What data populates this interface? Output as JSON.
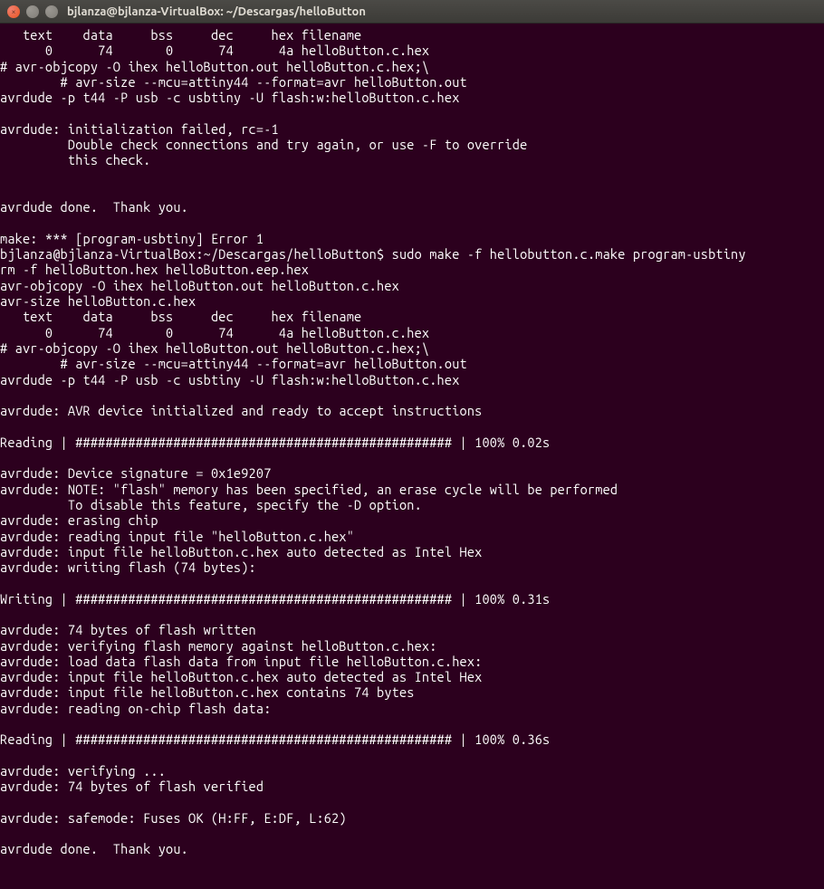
{
  "window": {
    "title": "bjlanza@bjlanza-VirtualBox: ~/Descargas/helloButton"
  },
  "terminal": {
    "lines": [
      "   text    data     bss     dec     hex filename",
      "      0      74       0      74      4a helloButton.c.hex",
      "# avr-objcopy -O ihex helloButton.out helloButton.c.hex;\\",
      "        # avr-size --mcu=attiny44 --format=avr helloButton.out",
      "avrdude -p t44 -P usb -c usbtiny -U flash:w:helloButton.c.hex",
      "",
      "avrdude: initialization failed, rc=-1",
      "         Double check connections and try again, or use -F to override",
      "         this check.",
      "",
      "",
      "avrdude done.  Thank you.",
      "",
      "make: *** [program-usbtiny] Error 1",
      "bjlanza@bjlanza-VirtualBox:~/Descargas/helloButton$ sudo make -f hellobutton.c.make program-usbtiny",
      "rm -f helloButton.hex helloButton.eep.hex",
      "avr-objcopy -O ihex helloButton.out helloButton.c.hex",
      "avr-size helloButton.c.hex",
      "   text    data     bss     dec     hex filename",
      "      0      74       0      74      4a helloButton.c.hex",
      "# avr-objcopy -O ihex helloButton.out helloButton.c.hex;\\",
      "        # avr-size --mcu=attiny44 --format=avr helloButton.out",
      "avrdude -p t44 -P usb -c usbtiny -U flash:w:helloButton.c.hex",
      "",
      "avrdude: AVR device initialized and ready to accept instructions",
      "",
      "Reading | ################################################## | 100% 0.02s",
      "",
      "avrdude: Device signature = 0x1e9207",
      "avrdude: NOTE: \"flash\" memory has been specified, an erase cycle will be performed",
      "         To disable this feature, specify the -D option.",
      "avrdude: erasing chip",
      "avrdude: reading input file \"helloButton.c.hex\"",
      "avrdude: input file helloButton.c.hex auto detected as Intel Hex",
      "avrdude: writing flash (74 bytes):",
      "",
      "Writing | ################################################## | 100% 0.31s",
      "",
      "avrdude: 74 bytes of flash written",
      "avrdude: verifying flash memory against helloButton.c.hex:",
      "avrdude: load data flash data from input file helloButton.c.hex:",
      "avrdude: input file helloButton.c.hex auto detected as Intel Hex",
      "avrdude: input file helloButton.c.hex contains 74 bytes",
      "avrdude: reading on-chip flash data:",
      "",
      "Reading | ################################################## | 100% 0.36s",
      "",
      "avrdude: verifying ...",
      "avrdude: 74 bytes of flash verified",
      "",
      "avrdude: safemode: Fuses OK (H:FF, E:DF, L:62)",
      "",
      "avrdude done.  Thank you.",
      ""
    ]
  }
}
